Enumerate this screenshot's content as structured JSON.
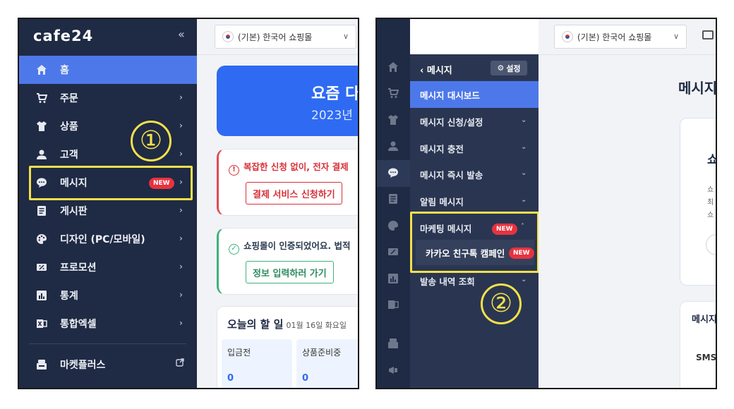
{
  "brand": {
    "logo": "cafe24",
    "collapse": "«"
  },
  "panel1": {
    "nav": [
      {
        "label": "홈"
      },
      {
        "label": "주문"
      },
      {
        "label": "상품"
      },
      {
        "label": "고객"
      },
      {
        "label": "메시지",
        "badge": "NEW"
      },
      {
        "label": "게시판"
      },
      {
        "label": "디자인 (PC/모바일)"
      },
      {
        "label": "프로모션"
      },
      {
        "label": "통계"
      },
      {
        "label": "통합엑셀"
      }
    ],
    "nav_bottom": [
      {
        "label": "마켓플러스"
      }
    ],
    "step_marker": "①",
    "shop_select": "(기본) 한국어 쇼핑몰",
    "banner": {
      "title": "요즘 다",
      "year": "2023년"
    },
    "alert_red": {
      "message": "복잡한 신청 없이, 전자 결제",
      "button": "결제 서비스 신청하기"
    },
    "alert_green": {
      "message": "쇼핑몰이 인증되었어요. 법적",
      "button": "정보 입력하러 가기"
    },
    "todo": {
      "title": "오늘의 할 일",
      "date": "01월 16일 화요일",
      "cells": [
        {
          "label": "입금전",
          "value": "0"
        },
        {
          "label": "상품준비중",
          "value": "0"
        }
      ]
    }
  },
  "panel2": {
    "back_label": "메시지",
    "settings_label": "설정",
    "items": [
      {
        "label": "메시지 대시보드"
      },
      {
        "label": "메시지 신청/설정"
      },
      {
        "label": "메시지 충전"
      },
      {
        "label": "메시지 즉시 발송"
      },
      {
        "label": "알림 메시지"
      },
      {
        "label": "마케팅 메시지",
        "badge": "NEW"
      },
      {
        "label": "발송 내역 조회"
      }
    ],
    "sub_item": {
      "label": "카카오 친구톡 캠페인",
      "badge": "NEW"
    },
    "step_marker": "②",
    "shop_select": "(기본) 한국어 쇼핑몰",
    "page_title": "메시지",
    "card_heading": "쇼",
    "card_lines": [
      "쇼",
      "최",
      "쇼"
    ],
    "card3_heading": "메시지",
    "card3_sms": "SMS"
  },
  "colors": {
    "sidebar": "#1f2a44",
    "active": "#4d78e9",
    "highlight": "#f5e04b",
    "badge": "#e8323f",
    "banner": "#2f6bf2",
    "alert_red": "#d83139",
    "alert_green": "#3db37a"
  }
}
